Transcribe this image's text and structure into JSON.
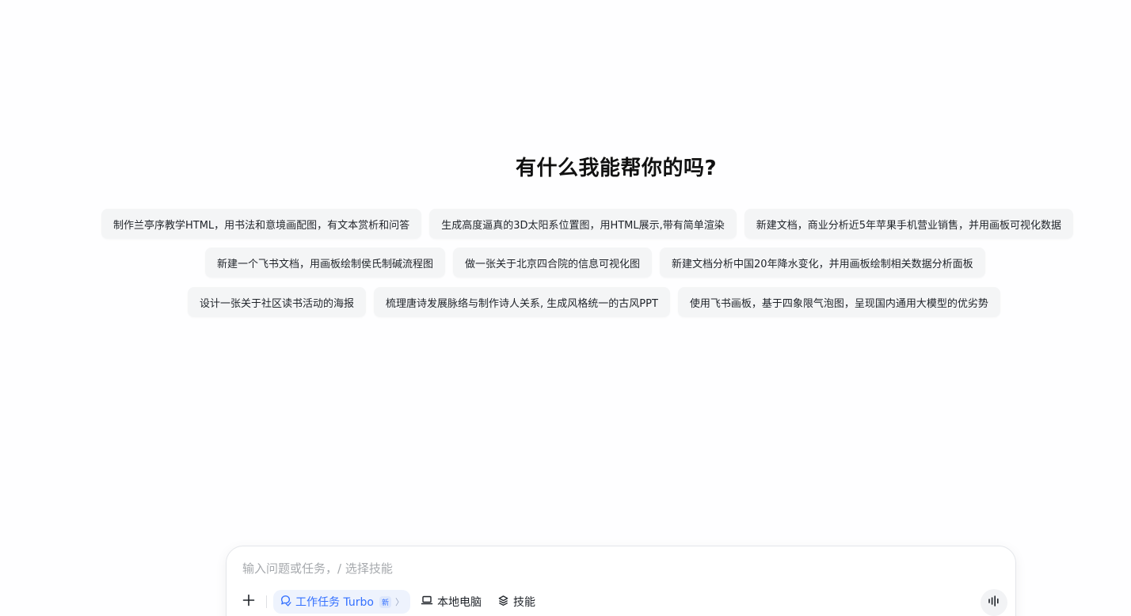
{
  "heading": "有什么我能帮你的吗?",
  "suggestions": {
    "row1": [
      "制作兰亭序教学HTML，用书法和意境画配图，有文本赏析和问答",
      "生成高度逼真的3D太阳系位置图，用HTML展示,带有简单渲染",
      "新建文档，商业分析近5年苹果手机营业销售，并用画板可视化数据"
    ],
    "row2": [
      "新建一个飞书文档，用画板绘制侯氏制碱流程图",
      "做一张关于北京四合院的信息可视化图",
      "新建文档分析中国20年降水变化，并用画板绘制相关数据分析面板"
    ],
    "row3": [
      "设计一张关于社区读书活动的海报",
      "梳理唐诗发展脉络与制作诗人关系, 生成风格统一的古风PPT",
      "使用飞书画板，基于四象限气泡图，呈现国内通用大模型的优劣势"
    ]
  },
  "composer": {
    "placeholder": "输入问题或任务，/ 选择技能",
    "mode_label": "工作任务 Turbo",
    "mode_badge": "新",
    "local_label": "本地电脑",
    "skills_label": "技能",
    "icons": {
      "add": "plus-icon",
      "mode": "task-icon",
      "local": "laptop-icon",
      "skills": "layers-icon",
      "voice": "voice-wave-icon"
    },
    "accent_color": "#3370ff"
  }
}
